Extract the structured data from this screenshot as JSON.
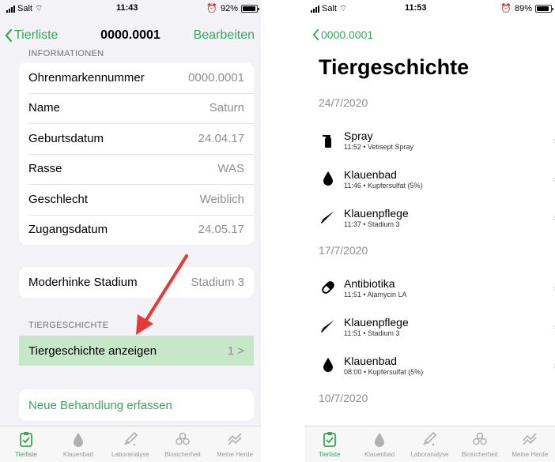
{
  "left": {
    "status": {
      "carrier": "Salt",
      "time": "11:43",
      "battery": "92%",
      "battery_level": 0.92
    },
    "nav": {
      "back": "Tierliste",
      "title": "0000.0001",
      "edit": "Bearbeiten"
    },
    "info_header": "INFORMATIONEN",
    "info_rows": [
      {
        "label": "Ohrenmarkennummer",
        "value": "0000.0001"
      },
      {
        "label": "Name",
        "value": "Saturn"
      },
      {
        "label": "Geburtsdatum",
        "value": "24.04.17"
      },
      {
        "label": "Rasse",
        "value": "WAS"
      },
      {
        "label": "Geschlecht",
        "value": "Weiblich"
      },
      {
        "label": "Zugangsdatum",
        "value": "24.05.17"
      }
    ],
    "stage": {
      "label": "Moderhinke Stadium",
      "value": "Stadium 3"
    },
    "history_header": "TIERGESCHICHTE",
    "history_row": {
      "label": "Tiergeschichte anzeigen",
      "count": "1",
      "chevron": ">"
    },
    "new_treatment": "Neue Behandlung erfassen"
  },
  "right": {
    "status": {
      "carrier": "Salt",
      "time": "11:53",
      "battery": "89%",
      "battery_level": 0.89
    },
    "back": "0000.0001",
    "title": "Tiergeschichte",
    "groups": [
      {
        "date": "24/7/2020",
        "entries": [
          {
            "icon": "spray-icon",
            "name": "Spray",
            "detail": "11:52 • Vetisept Spray"
          },
          {
            "icon": "drop-icon",
            "name": "Klauenbad",
            "detail": "11:46 • Kupfersulfat (5%)"
          },
          {
            "icon": "knife-icon",
            "name": "Klauenpflege",
            "detail": "11:37 • Stadium 3"
          }
        ]
      },
      {
        "date": "17/7/2020",
        "entries": [
          {
            "icon": "pill-icon",
            "name": "Antibiotika",
            "detail": "11:51 • Alamycin LA"
          },
          {
            "icon": "knife-icon",
            "name": "Klauenpflege",
            "detail": "11:51 • Stadium 3"
          },
          {
            "icon": "drop-icon",
            "name": "Klauenbad",
            "detail": "08:00 • Kupfersulfat (5%)"
          }
        ]
      },
      {
        "date": "10/7/2020",
        "entries": []
      }
    ]
  },
  "tabs": [
    "Tierliste",
    "Klauenbad",
    "Laboranalyse",
    "Biosicherheit",
    "Meine Herde"
  ],
  "colors": {
    "accent": "#3aa55a",
    "highlight": "#c6e7c8",
    "arrow": "#e53935"
  }
}
